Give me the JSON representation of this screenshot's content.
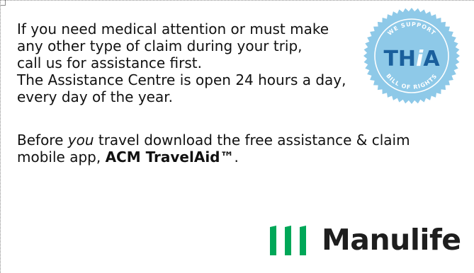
{
  "intro": {
    "lines": [
      "If you need medical attention or must make",
      "any other type of claim during your trip,",
      "call us for assistance first.",
      "The Assistance Centre is open 24 hours a day,",
      "every day of the year."
    ]
  },
  "app_note": {
    "before": "Before ",
    "you": "you",
    "after_you": " travel download the free assistance & claim",
    "line2_start": "mobile app, ",
    "app_name": "ACM TravelAid™",
    "end": "."
  },
  "seal": {
    "top_text": "WE SUPPORT",
    "center_text": "TH",
    "center_italic": "i",
    "center_end": "A",
    "bottom_text": "BILL OF RIGHTS",
    "color": "#8ec9e8",
    "text_color": "#ffffff",
    "accent": "#1a5f9c"
  },
  "logo": {
    "wordmark": "Manulife",
    "mark_color": "#00a758",
    "text_color": "#1e1e1e"
  }
}
